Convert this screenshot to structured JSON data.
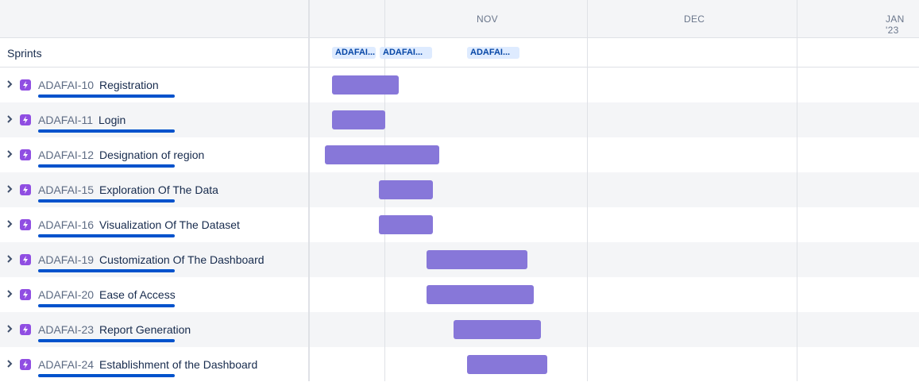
{
  "timeline": {
    "months": [
      "NOV",
      "DEC",
      "JAN '23"
    ],
    "sprints_label": "Sprints",
    "sprints": [
      "ADAFAI...",
      "ADAFAI...",
      "ADAFAI..."
    ],
    "bar_color": "#8777d9",
    "epic_color": "#904ee2",
    "progress_color": "#0052cc"
  },
  "issues": [
    {
      "key": "ADAFAI-10",
      "summary": "Registration"
    },
    {
      "key": "ADAFAI-11",
      "summary": "Login"
    },
    {
      "key": "ADAFAI-12",
      "summary": "Designation of region"
    },
    {
      "key": "ADAFAI-15",
      "summary": "Exploration Of The Data"
    },
    {
      "key": "ADAFAI-16",
      "summary": "Visualization Of The Dataset"
    },
    {
      "key": "ADAFAI-19",
      "summary": "Customization Of The Dashboard"
    },
    {
      "key": "ADAFAI-20",
      "summary": "Ease of Access"
    },
    {
      "key": "ADAFAI-23",
      "summary": "Report Generation"
    },
    {
      "key": "ADAFAI-24",
      "summary": "Establishment of the Dashboard"
    }
  ]
}
